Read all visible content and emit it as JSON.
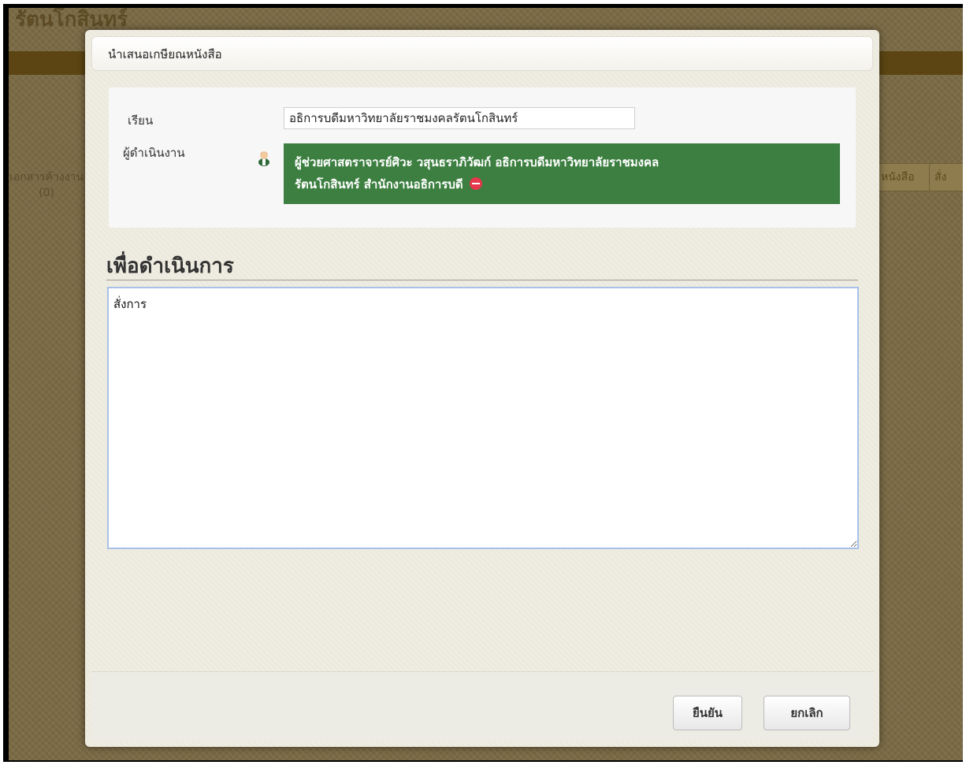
{
  "background": {
    "title": "รัตนโกสินทร์",
    "stat": {
      "label": "เอกสารค้างงาน",
      "count": "(0)"
    },
    "buttons": [
      "หนังสือ",
      "สั่ง"
    ]
  },
  "dialog": {
    "title": "นำเสนอเกษียณหนังสือ",
    "to_label": "เรียน",
    "to_value": "อธิการบดีมหาวิทยาลัยราชมงคลรัตนโกสินทร์",
    "operator_label": "ผู้ดำเนินงาน",
    "operator": {
      "line1": "ผู้ช่วยศาสตราจารย์ศิวะ วสุนธราภิวัฒก์ อธิการบดีมหาวิทยาลัยราชมงคล",
      "line2": "รัตนโกสินทร์ สำนักงานอธิการบดี"
    },
    "section_heading": "เพื่อดำเนินการ",
    "note_value": "สั่งการ",
    "confirm_label": "ยืนยัน",
    "cancel_label": "ยกเลิก"
  },
  "colors": {
    "operator_bg": "#3d7f41",
    "remove_icon": "#e6374c",
    "focus_border": "#a7c1e8"
  },
  "icons": {
    "operator": "person-icon",
    "remove": "remove-icon",
    "resize": "resize-grip-icon"
  }
}
